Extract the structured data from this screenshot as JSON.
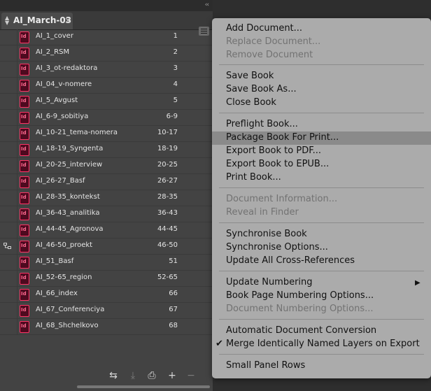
{
  "panel": {
    "collapse_glyph": "‹‹",
    "tab_title": "AI_March-03",
    "tab_close": "×",
    "rows": [
      {
        "name": "AI_1_cover",
        "pages": "1",
        "sync_icon": false
      },
      {
        "name": "AI_2_RSM",
        "pages": "2",
        "sync_icon": false
      },
      {
        "name": "AI_3_ot-redaktora",
        "pages": "3",
        "sync_icon": false
      },
      {
        "name": "AI_04_v-nomere",
        "pages": "4",
        "sync_icon": false
      },
      {
        "name": "AI_5_Avgust",
        "pages": "5",
        "sync_icon": false
      },
      {
        "name": "AI_6-9_sobitiya",
        "pages": "6-9",
        "sync_icon": false
      },
      {
        "name": "AI_10-21_tema-nomera",
        "pages": "10-17",
        "sync_icon": false
      },
      {
        "name": "AI_18-19_Syngenta",
        "pages": "18-19",
        "sync_icon": false
      },
      {
        "name": "AI_20-25_interview",
        "pages": "20-25",
        "sync_icon": false
      },
      {
        "name": "AI_26-27_Basf",
        "pages": "26-27",
        "sync_icon": false
      },
      {
        "name": "AI_28-35_kontekst",
        "pages": "28-35",
        "sync_icon": false
      },
      {
        "name": "AI_36-43_analitika",
        "pages": "36-43",
        "sync_icon": false
      },
      {
        "name": "AI_44-45_Agronova",
        "pages": "44-45",
        "sync_icon": false
      },
      {
        "name": "AI_46-50_proekt",
        "pages": "46-50",
        "sync_icon": true
      },
      {
        "name": "AI_51_Basf",
        "pages": "51",
        "sync_icon": false
      },
      {
        "name": "AI_52-65_region",
        "pages": "52-65",
        "sync_icon": false
      },
      {
        "name": "AI_66_index",
        "pages": "66",
        "sync_icon": false
      },
      {
        "name": "AI_67_Conferenciya",
        "pages": "67",
        "sync_icon": false
      },
      {
        "name": "AI_68_Shchelkovo",
        "pages": "68",
        "sync_icon": false
      }
    ],
    "doc_icon_label": "Id",
    "doc_icon_color": "#ff3366",
    "bottom_buttons": [
      {
        "icon": "synchronize-icon",
        "glyph": "⇆",
        "enabled": true
      },
      {
        "icon": "save-book-icon",
        "glyph": "⤓",
        "enabled": false
      },
      {
        "icon": "print-book-icon",
        "glyph": "⎙",
        "enabled": true
      },
      {
        "icon": "add-document-icon",
        "glyph": "+",
        "enabled": true
      },
      {
        "icon": "remove-document-icon",
        "glyph": "−",
        "enabled": false
      }
    ]
  },
  "menu": {
    "items": [
      {
        "label": "Add Document...",
        "enabled": true
      },
      {
        "label": "Replace Document...",
        "enabled": false
      },
      {
        "label": "Remove Document",
        "enabled": false
      },
      {
        "label": "Save Book",
        "enabled": true
      },
      {
        "label": "Save Book As...",
        "enabled": true
      },
      {
        "label": "Close Book",
        "enabled": true
      },
      {
        "label": "Preflight Book...",
        "enabled": true
      },
      {
        "label": "Package Book For Print...",
        "enabled": true,
        "highlighted": true
      },
      {
        "label": "Export Book to PDF...",
        "enabled": true
      },
      {
        "label": "Export Book to EPUB...",
        "enabled": true
      },
      {
        "label": "Print Book...",
        "enabled": true
      },
      {
        "label": "Document Information...",
        "enabled": false
      },
      {
        "label": "Reveal in Finder",
        "enabled": false
      },
      {
        "label": "Synchronise Book",
        "enabled": true
      },
      {
        "label": "Synchronise Options...",
        "enabled": true
      },
      {
        "label": "Update All Cross-References",
        "enabled": true
      },
      {
        "label": "Update Numbering",
        "enabled": true,
        "submenu": true
      },
      {
        "label": "Book Page Numbering Options...",
        "enabled": true
      },
      {
        "label": "Document Numbering Options...",
        "enabled": false
      },
      {
        "label": "Automatic Document Conversion",
        "enabled": true
      },
      {
        "label": "Merge Identically Named Layers on Export",
        "enabled": true,
        "checked": true
      },
      {
        "label": "Small Panel Rows",
        "enabled": true
      }
    ],
    "check_glyph": "✔",
    "submenu_glyph": "▶"
  }
}
